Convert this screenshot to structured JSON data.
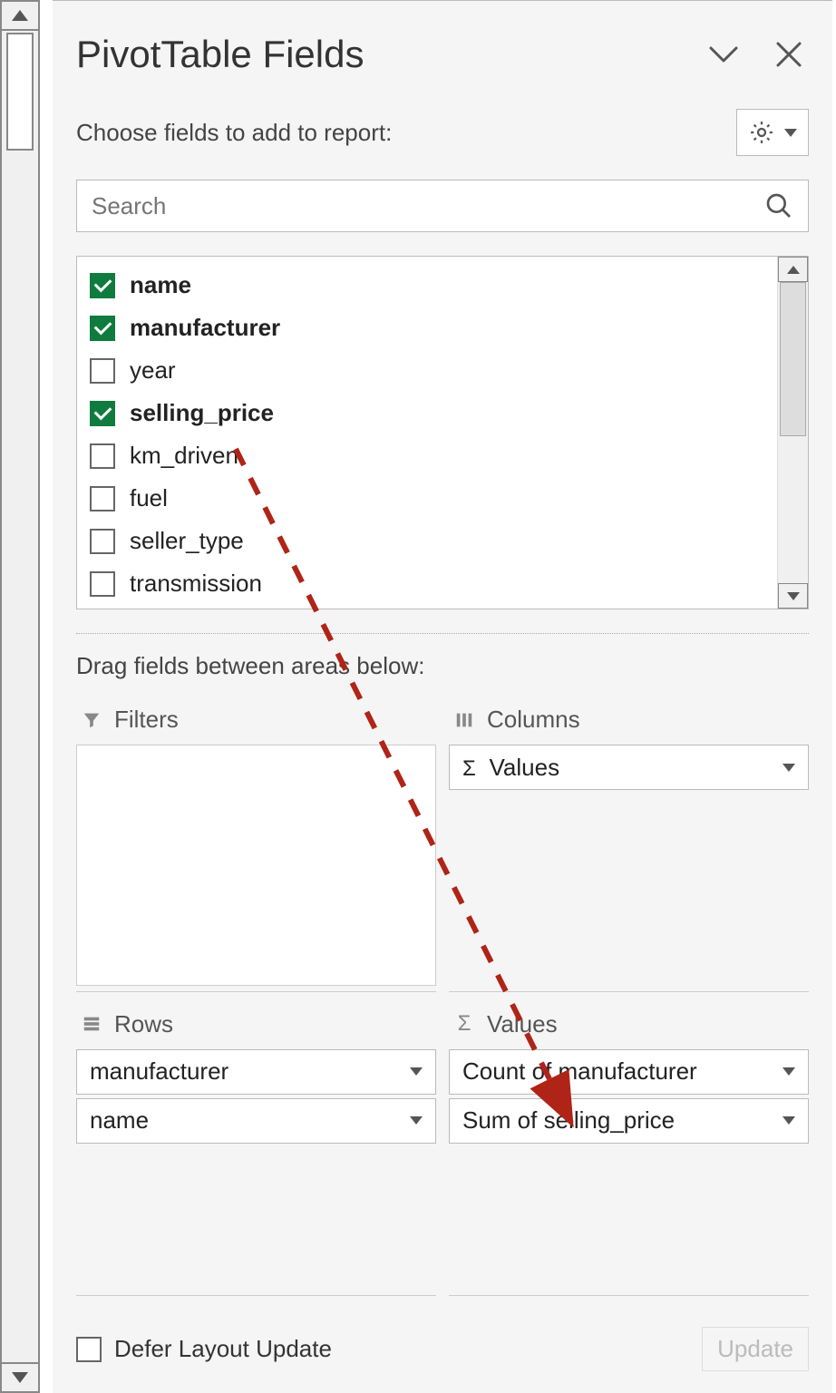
{
  "header": {
    "title": "PivotTable Fields"
  },
  "subtitle": "Choose fields to add to report:",
  "search": {
    "placeholder": "Search"
  },
  "fields": [
    {
      "label": "name",
      "checked": true
    },
    {
      "label": "manufacturer",
      "checked": true
    },
    {
      "label": "year",
      "checked": false
    },
    {
      "label": "selling_price",
      "checked": true
    },
    {
      "label": "km_driven",
      "checked": false
    },
    {
      "label": "fuel",
      "checked": false
    },
    {
      "label": "seller_type",
      "checked": false
    },
    {
      "label": "transmission",
      "checked": false
    }
  ],
  "drag_label": "Drag fields between areas below:",
  "areas": {
    "filters": {
      "label": "Filters",
      "items": []
    },
    "columns": {
      "label": "Columns",
      "items": [
        "Values"
      ],
      "sigma": true
    },
    "rows": {
      "label": "Rows",
      "items": [
        "manufacturer",
        "name"
      ]
    },
    "values": {
      "label": "Values",
      "items": [
        "Count of manufacturer",
        "Sum of selling_price"
      ]
    }
  },
  "footer": {
    "defer_label": "Defer Layout Update",
    "update_label": "Update"
  }
}
